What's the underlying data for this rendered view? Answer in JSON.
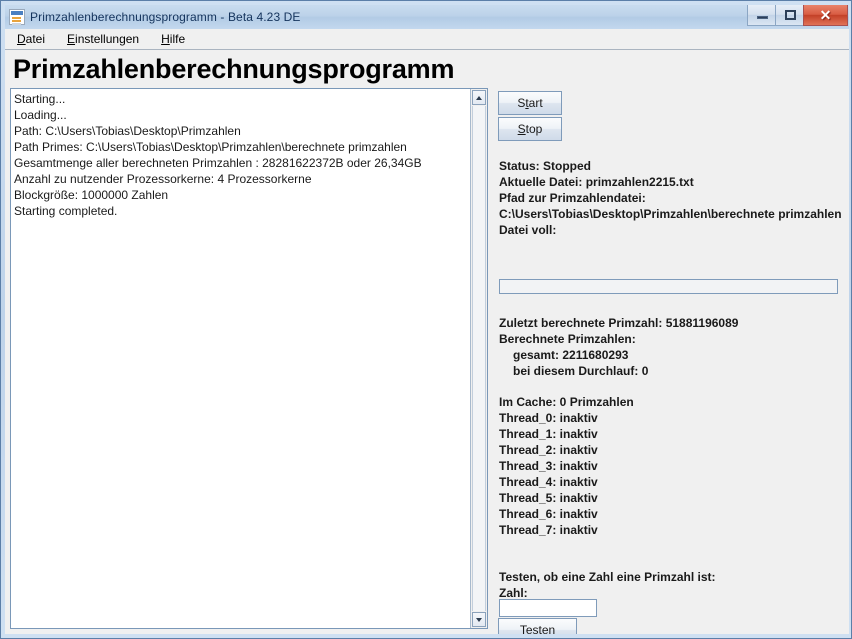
{
  "window": {
    "title": "Primzahlenberechnungsprogramm - Beta 4.23 DE",
    "icon": "document-icon",
    "controls": {
      "minimize": "minimize-icon",
      "maximize": "maximize-icon",
      "close": "✕"
    }
  },
  "menu": [
    {
      "label": "Datei",
      "mnemonic": "D",
      "rest": "atei"
    },
    {
      "label": "Einstellungen",
      "mnemonic": "E",
      "rest": "instellungen"
    },
    {
      "label": "Hilfe",
      "mnemonic": "H",
      "rest": "ilfe"
    }
  ],
  "heading": "Primzahlenberechnungsprogramm",
  "log": {
    "lines": [
      "Starting...",
      "Loading...",
      "Path: C:\\Users\\Tobias\\Desktop\\Primzahlen",
      "Path Primes: C:\\Users\\Tobias\\Desktop\\Primzahlen\\berechnete primzahlen",
      "Gesamtmenge aller berechneten Primzahlen : 28281622372B oder 26,34GB",
      "Anzahl zu nutzender Prozessorkerne: 4 Prozessorkerne",
      "Blockgröße: 1000000 Zahlen",
      "Starting completed."
    ],
    "scrollbar": {
      "up": "scroll-up-arrow",
      "down": "scroll-down-arrow"
    }
  },
  "controls": {
    "start": {
      "pre": "S",
      "mnemonic": "t",
      "post": "art",
      "label": "Start"
    },
    "stop": {
      "pre": "",
      "mnemonic": "S",
      "post": "top",
      "label": "Stop"
    },
    "test": {
      "pre": "T",
      "mnemonic": "e",
      "post": "sten",
      "label": "Testen"
    }
  },
  "status": {
    "line1": "Status: Stopped",
    "line2": "Aktuelle Datei: primzahlen2215.txt",
    "line3": "Pfad zur Primzahlendatei:",
    "line4": "C:\\Users\\Tobias\\Desktop\\Primzahlen\\berechnete primzahlen",
    "line5": "Datei voll:",
    "progress_percent": 0
  },
  "primes": {
    "last": "Zuletzt berechnete Primzahl: 51881196089",
    "computed_label": "Berechnete Primzahlen:",
    "total": "gesamt: 2211680293",
    "this_run": "bei diesem Durchlauf: 0",
    "cache": "Im Cache: 0 Primzahlen"
  },
  "threads": [
    "Thread_0: inaktiv",
    "Thread_1: inaktiv",
    "Thread_2: inaktiv",
    "Thread_3: inaktiv",
    "Thread_4: inaktiv",
    "Thread_5: inaktiv",
    "Thread_6: inaktiv",
    "Thread_7: inaktiv"
  ],
  "test": {
    "prompt": "Testen, ob eine Zahl eine Primzahl ist:",
    "field_label": "Zahl:",
    "field_value": "",
    "field_placeholder": ""
  },
  "colors": {
    "titlebar": "#bcd2e9",
    "panel": "#f0f0f0",
    "border": "#7f9bba",
    "close": "#c33f26"
  }
}
